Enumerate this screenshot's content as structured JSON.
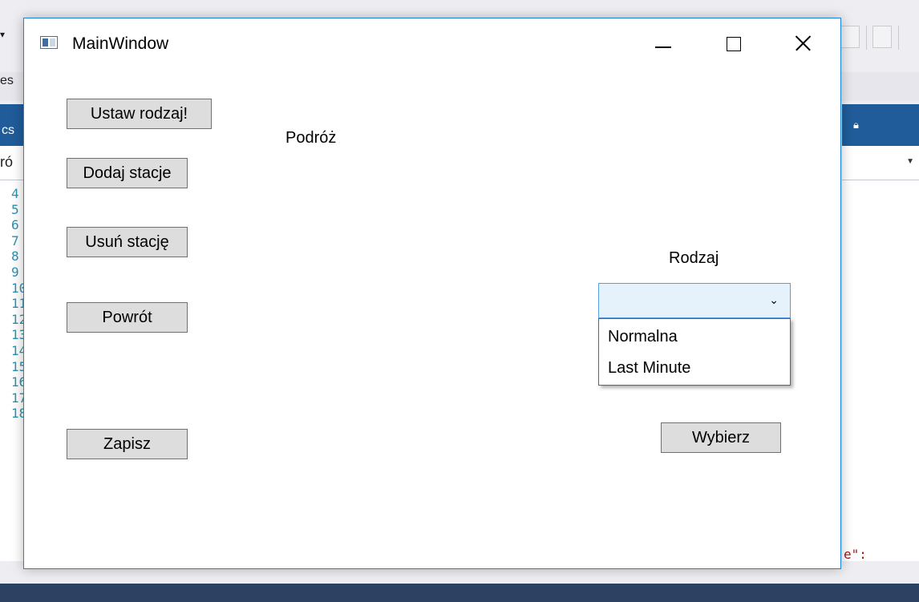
{
  "background_ide": {
    "left_fragment_1": "es",
    "left_tab_text": "cs",
    "left_fragment_2": "ró",
    "line_numbers": [
      "4",
      "5",
      "6",
      "7",
      "8",
      "9",
      "10",
      "11",
      "12",
      "13",
      "14",
      "15",
      "16",
      "17",
      "18"
    ],
    "right_code_fragment": "e\":"
  },
  "window": {
    "title": "MainWindow"
  },
  "buttons": {
    "set_type": "Ustaw rodzaj!",
    "add_station": "Dodaj stacje",
    "remove_station": "Usuń stację",
    "back": "Powrót",
    "save": "Zapisz",
    "choose": "Wybierz"
  },
  "labels": {
    "journey": "Podróż",
    "type": "Rodzaj"
  },
  "combobox": {
    "selected": "",
    "options": [
      "Normalna",
      "Last Minute"
    ]
  }
}
